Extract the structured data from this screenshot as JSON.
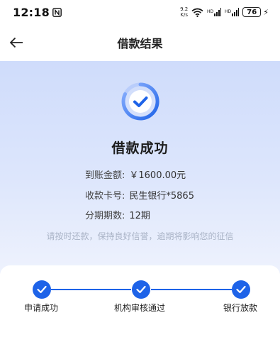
{
  "status_bar": {
    "time": "12:18",
    "net_speed_value": "9.2",
    "net_speed_unit": "K/s",
    "battery": "76",
    "icons": [
      "nfc-icon",
      "wifi-icon",
      "signal-icon",
      "signal-icon",
      "battery-icon",
      "charging-icon"
    ]
  },
  "header": {
    "title": "借款结果",
    "back_icon": "arrow-left-icon"
  },
  "result": {
    "icon": "check-circle-icon",
    "title": "借款成功",
    "rows": [
      {
        "label": "到账金额:",
        "value": "￥1600.00元"
      },
      {
        "label": "收款卡号:",
        "value": "民生银行*5865"
      },
      {
        "label": "分期期数:",
        "value": "12期"
      }
    ],
    "notice": "请按时还款，保持良好信誉，逾期将影响您的征信"
  },
  "progress": {
    "steps": [
      {
        "label": "申请成功",
        "done": true
      },
      {
        "label": "机构审核通过",
        "done": true
      },
      {
        "label": "银行放款",
        "done": true
      }
    ]
  },
  "colors": {
    "accent": "#1e63e8",
    "hero_top": "#cfdcfb",
    "hero_bottom": "#eef2fd",
    "notice_text": "#a9b3c6"
  }
}
